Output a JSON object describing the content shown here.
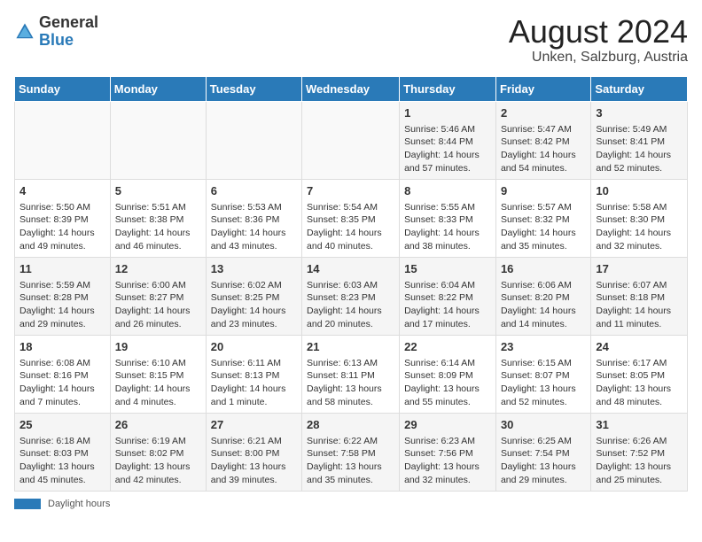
{
  "header": {
    "logo_general": "General",
    "logo_blue": "Blue",
    "month_title": "August 2024",
    "location": "Unken, Salzburg, Austria"
  },
  "days_of_week": [
    "Sunday",
    "Monday",
    "Tuesday",
    "Wednesday",
    "Thursday",
    "Friday",
    "Saturday"
  ],
  "weeks": [
    [
      {
        "day": "",
        "info": ""
      },
      {
        "day": "",
        "info": ""
      },
      {
        "day": "",
        "info": ""
      },
      {
        "day": "",
        "info": ""
      },
      {
        "day": "1",
        "info": "Sunrise: 5:46 AM\nSunset: 8:44 PM\nDaylight: 14 hours and 57 minutes."
      },
      {
        "day": "2",
        "info": "Sunrise: 5:47 AM\nSunset: 8:42 PM\nDaylight: 14 hours and 54 minutes."
      },
      {
        "day": "3",
        "info": "Sunrise: 5:49 AM\nSunset: 8:41 PM\nDaylight: 14 hours and 52 minutes."
      }
    ],
    [
      {
        "day": "4",
        "info": "Sunrise: 5:50 AM\nSunset: 8:39 PM\nDaylight: 14 hours and 49 minutes."
      },
      {
        "day": "5",
        "info": "Sunrise: 5:51 AM\nSunset: 8:38 PM\nDaylight: 14 hours and 46 minutes."
      },
      {
        "day": "6",
        "info": "Sunrise: 5:53 AM\nSunset: 8:36 PM\nDaylight: 14 hours and 43 minutes."
      },
      {
        "day": "7",
        "info": "Sunrise: 5:54 AM\nSunset: 8:35 PM\nDaylight: 14 hours and 40 minutes."
      },
      {
        "day": "8",
        "info": "Sunrise: 5:55 AM\nSunset: 8:33 PM\nDaylight: 14 hours and 38 minutes."
      },
      {
        "day": "9",
        "info": "Sunrise: 5:57 AM\nSunset: 8:32 PM\nDaylight: 14 hours and 35 minutes."
      },
      {
        "day": "10",
        "info": "Sunrise: 5:58 AM\nSunset: 8:30 PM\nDaylight: 14 hours and 32 minutes."
      }
    ],
    [
      {
        "day": "11",
        "info": "Sunrise: 5:59 AM\nSunset: 8:28 PM\nDaylight: 14 hours and 29 minutes."
      },
      {
        "day": "12",
        "info": "Sunrise: 6:00 AM\nSunset: 8:27 PM\nDaylight: 14 hours and 26 minutes."
      },
      {
        "day": "13",
        "info": "Sunrise: 6:02 AM\nSunset: 8:25 PM\nDaylight: 14 hours and 23 minutes."
      },
      {
        "day": "14",
        "info": "Sunrise: 6:03 AM\nSunset: 8:23 PM\nDaylight: 14 hours and 20 minutes."
      },
      {
        "day": "15",
        "info": "Sunrise: 6:04 AM\nSunset: 8:22 PM\nDaylight: 14 hours and 17 minutes."
      },
      {
        "day": "16",
        "info": "Sunrise: 6:06 AM\nSunset: 8:20 PM\nDaylight: 14 hours and 14 minutes."
      },
      {
        "day": "17",
        "info": "Sunrise: 6:07 AM\nSunset: 8:18 PM\nDaylight: 14 hours and 11 minutes."
      }
    ],
    [
      {
        "day": "18",
        "info": "Sunrise: 6:08 AM\nSunset: 8:16 PM\nDaylight: 14 hours and 7 minutes."
      },
      {
        "day": "19",
        "info": "Sunrise: 6:10 AM\nSunset: 8:15 PM\nDaylight: 14 hours and 4 minutes."
      },
      {
        "day": "20",
        "info": "Sunrise: 6:11 AM\nSunset: 8:13 PM\nDaylight: 14 hours and 1 minute."
      },
      {
        "day": "21",
        "info": "Sunrise: 6:13 AM\nSunset: 8:11 PM\nDaylight: 13 hours and 58 minutes."
      },
      {
        "day": "22",
        "info": "Sunrise: 6:14 AM\nSunset: 8:09 PM\nDaylight: 13 hours and 55 minutes."
      },
      {
        "day": "23",
        "info": "Sunrise: 6:15 AM\nSunset: 8:07 PM\nDaylight: 13 hours and 52 minutes."
      },
      {
        "day": "24",
        "info": "Sunrise: 6:17 AM\nSunset: 8:05 PM\nDaylight: 13 hours and 48 minutes."
      }
    ],
    [
      {
        "day": "25",
        "info": "Sunrise: 6:18 AM\nSunset: 8:03 PM\nDaylight: 13 hours and 45 minutes."
      },
      {
        "day": "26",
        "info": "Sunrise: 6:19 AM\nSunset: 8:02 PM\nDaylight: 13 hours and 42 minutes."
      },
      {
        "day": "27",
        "info": "Sunrise: 6:21 AM\nSunset: 8:00 PM\nDaylight: 13 hours and 39 minutes."
      },
      {
        "day": "28",
        "info": "Sunrise: 6:22 AM\nSunset: 7:58 PM\nDaylight: 13 hours and 35 minutes."
      },
      {
        "day": "29",
        "info": "Sunrise: 6:23 AM\nSunset: 7:56 PM\nDaylight: 13 hours and 32 minutes."
      },
      {
        "day": "30",
        "info": "Sunrise: 6:25 AM\nSunset: 7:54 PM\nDaylight: 13 hours and 29 minutes."
      },
      {
        "day": "31",
        "info": "Sunrise: 6:26 AM\nSunset: 7:52 PM\nDaylight: 13 hours and 25 minutes."
      }
    ]
  ],
  "footer": {
    "daylight_label": "Daylight hours"
  }
}
